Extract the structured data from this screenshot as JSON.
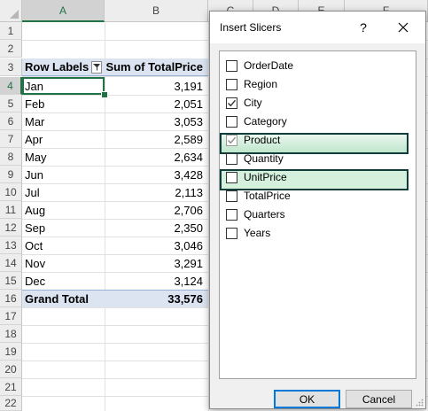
{
  "sheet": {
    "columns": [
      "A",
      "B",
      "C",
      "D",
      "E",
      "F"
    ],
    "rows": [
      "1",
      "2",
      "3",
      "4",
      "5",
      "6",
      "7",
      "8",
      "9",
      "10",
      "11",
      "12",
      "13",
      "14",
      "15",
      "16",
      "17",
      "18",
      "19",
      "20",
      "21",
      "22"
    ],
    "pivot": {
      "header_label": "Row Labels",
      "header_value": "Sum of TotalPrice",
      "rows": [
        {
          "label": "Jan",
          "value": "3,191"
        },
        {
          "label": "Feb",
          "value": "2,051"
        },
        {
          "label": "Mar",
          "value": "3,053"
        },
        {
          "label": "Apr",
          "value": "2,589"
        },
        {
          "label": "May",
          "value": "2,634"
        },
        {
          "label": "Jun",
          "value": "3,428"
        },
        {
          "label": "Jul",
          "value": "2,113"
        },
        {
          "label": "Aug",
          "value": "2,706"
        },
        {
          "label": "Sep",
          "value": "2,350"
        },
        {
          "label": "Oct",
          "value": "3,046"
        },
        {
          "label": "Nov",
          "value": "3,291"
        },
        {
          "label": "Dec",
          "value": "3,124"
        }
      ],
      "total_label": "Grand Total",
      "total_value": "33,576"
    },
    "colors": {
      "accent": "#217346",
      "pivot_header": "#dce4f2"
    }
  },
  "dialog": {
    "title": "Insert Slicers",
    "help": "?",
    "fields": [
      {
        "label": "OrderDate",
        "checked": false
      },
      {
        "label": "Region",
        "checked": false
      },
      {
        "label": "City",
        "checked": true
      },
      {
        "label": "Category",
        "checked": false
      },
      {
        "label": "Product",
        "checked": true
      },
      {
        "label": "Quantity",
        "checked": false
      },
      {
        "label": "UnitPrice",
        "checked": false
      },
      {
        "label": "TotalPrice",
        "checked": false
      },
      {
        "label": "Quarters",
        "checked": false
      },
      {
        "label": "Years",
        "checked": false
      }
    ],
    "ok_label": "OK",
    "cancel_label": "Cancel",
    "colors": {
      "highlight_border": "#103c3a",
      "highlight_fill": "#d6f0de"
    }
  }
}
